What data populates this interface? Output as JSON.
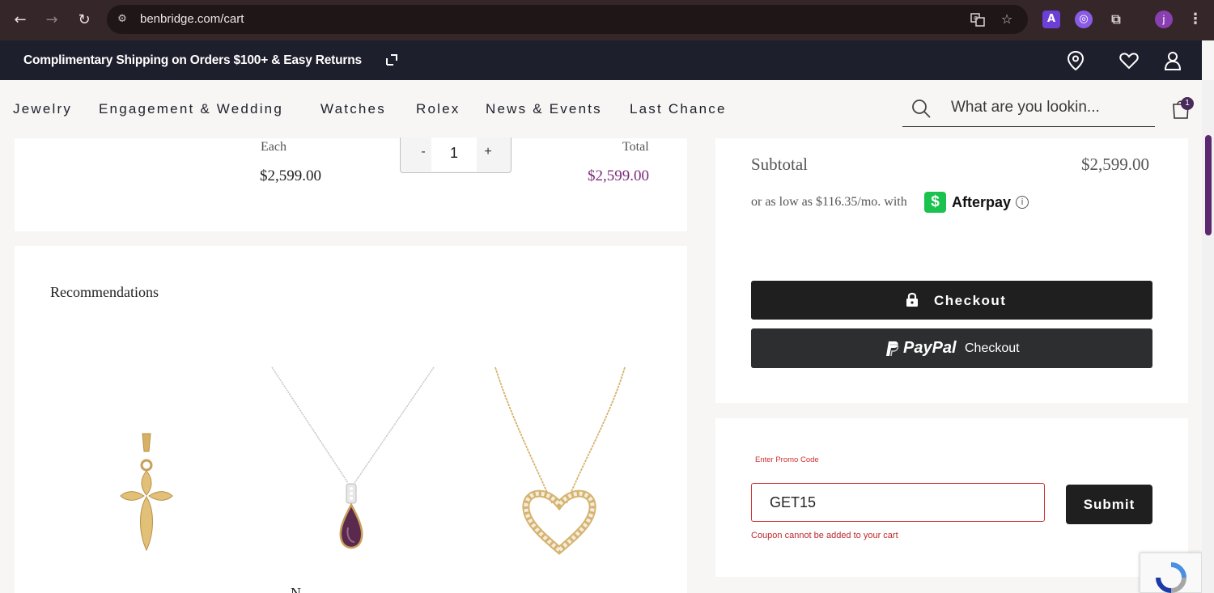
{
  "browser": {
    "url": "benbridge.com/cart",
    "profile_initial": "j",
    "extension_a_label": "A"
  },
  "promo_bar": {
    "text": "Complimentary Shipping on Orders $100+ & Easy Returns"
  },
  "nav": {
    "items": [
      "Jewelry",
      "Engagement & Wedding",
      "Watches",
      "Rolex",
      "News & Events",
      "Last Chance"
    ],
    "search_placeholder": "What are you lookin...",
    "cart_count": "1"
  },
  "cart_item": {
    "each_label": "Each",
    "each_price": "$2,599.00",
    "quantity": "1",
    "minus": "-",
    "plus": "+",
    "total_label": "Total",
    "total_price": "$2,599.00"
  },
  "recommendations": {
    "title": "Recommendations",
    "partial_label": "N"
  },
  "summary": {
    "subtotal_label": "Subtotal",
    "subtotal_value": "$2,599.00",
    "afterpay_text": "or as low as $116.35/mo. with",
    "afterpay_brand": "Afterpay",
    "checkout_label": "Checkout",
    "paypal_brand": "PayPal",
    "paypal_suffix": "Checkout"
  },
  "promo_code": {
    "label": "Enter Promo Code",
    "value": "GET15",
    "submit_label": "Submit",
    "error": "Coupon cannot be added to your cart"
  },
  "colors": {
    "header_bg": "#1e1f2c",
    "accent_purple": "#7b2a78",
    "error_red": "#d0302f",
    "afterpay_green": "#19c34e"
  }
}
